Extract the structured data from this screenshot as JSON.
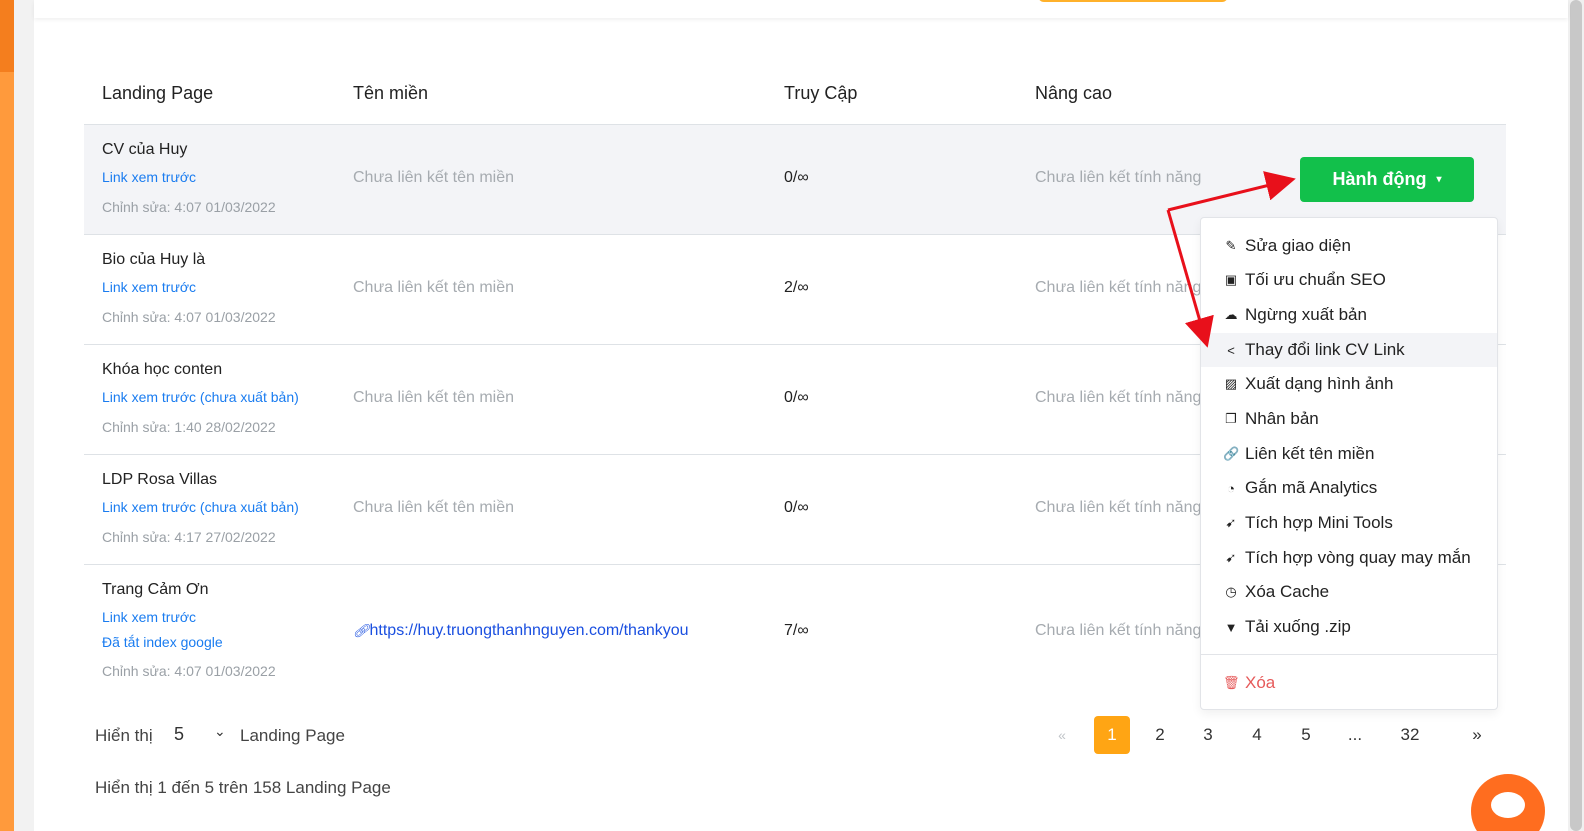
{
  "table": {
    "headers": [
      "Landing Page",
      "Tên miền",
      "Truy Cập",
      "Nâng cao"
    ],
    "rows": [
      {
        "name": "CV của Huy",
        "links": [
          "Link xem trước"
        ],
        "edited": "Chỉnh sửa: 4:07 01/03/2022",
        "domain": "Chưa liên kết tên miền",
        "access": "0/∞",
        "advanced": "Chưa liên kết tính năng"
      },
      {
        "name": "Bio của Huy là",
        "links": [
          "Link xem trước"
        ],
        "edited": "Chỉnh sửa: 4:07 01/03/2022",
        "domain": "Chưa liên kết tên miền",
        "access": "2/∞",
        "advanced": "Chưa liên kết tính năng"
      },
      {
        "name": "Khóa học conten",
        "links": [
          "Link xem trước (chưa xuất bản)"
        ],
        "edited": "Chỉnh sửa: 1:40 28/02/2022",
        "domain": "Chưa liên kết tên miền",
        "access": "0/∞",
        "advanced": "Chưa liên kết tính năng"
      },
      {
        "name": "LDP Rosa Villas",
        "links": [
          "Link xem trước (chưa xuất bản)"
        ],
        "edited": "Chỉnh sửa: 4:17 27/02/2022",
        "domain": "Chưa liên kết tên miền",
        "access": "0/∞",
        "advanced": "Chưa liên kết tính năng"
      },
      {
        "name": "Trang Cảm Ơn",
        "links": [
          "Link xem trước",
          "Đã tắt index google"
        ],
        "edited": "Chỉnh sửa: 4:07 01/03/2022",
        "domain": "https://huy.truongthanhnguyen.com/thankyou",
        "access": "7/∞",
        "advanced": "Chưa liên kết tính năng"
      }
    ]
  },
  "action_button": {
    "label": "Hành động",
    "caret": "▾",
    "color": "#12c04b"
  },
  "action_menu": {
    "items": [
      {
        "label": "Sửa giao diện",
        "icon": "edit-design-icon",
        "glyph": "✎"
      },
      {
        "label": "Tối ưu chuẩn SEO",
        "icon": "seo-icon",
        "glyph": "▣"
      },
      {
        "label": "Ngừng xuất bản",
        "icon": "cloud-upload-icon",
        "glyph": "☁"
      },
      {
        "label": "Thay đổi link CV Link",
        "icon": "share-icon",
        "glyph": "<"
      },
      {
        "label": "Xuất dạng hình ảnh",
        "icon": "image-icon",
        "glyph": "▨"
      },
      {
        "label": "Nhân bản",
        "icon": "duplicate-icon",
        "glyph": "❐"
      },
      {
        "label": "Liên kết tên miền",
        "icon": "link-icon",
        "glyph": "🔗"
      },
      {
        "label": "Gắn mã Analytics",
        "icon": "analytics-icon",
        "glyph": "◔"
      },
      {
        "label": "Tích hợp Mini Tools",
        "icon": "rocket-icon",
        "glyph": "➹"
      },
      {
        "label": "Tích hợp vòng quay may mắn",
        "icon": "rocket-icon",
        "glyph": "➹"
      },
      {
        "label": "Xóa Cache",
        "icon": "clock-icon",
        "glyph": "◷"
      },
      {
        "label": "Tải xuống .zip",
        "icon": "download-icon",
        "glyph": "▼"
      }
    ],
    "delete": {
      "label": "Xóa",
      "icon": "trash-icon",
      "glyph": "🗑"
    },
    "danger_color": "#e65a5a"
  },
  "footer": {
    "show_label": "Hiển thị",
    "page_size": "5",
    "page_size_suffix": "Landing Page",
    "summary": "Hiển thị 1 đến 5 trên 158 Landing Page"
  },
  "pagination": {
    "prev": "«",
    "pages": [
      "1",
      "2",
      "3",
      "4",
      "5",
      "...",
      "32"
    ],
    "next": "»",
    "active": "1",
    "active_color": "#ffa514"
  }
}
